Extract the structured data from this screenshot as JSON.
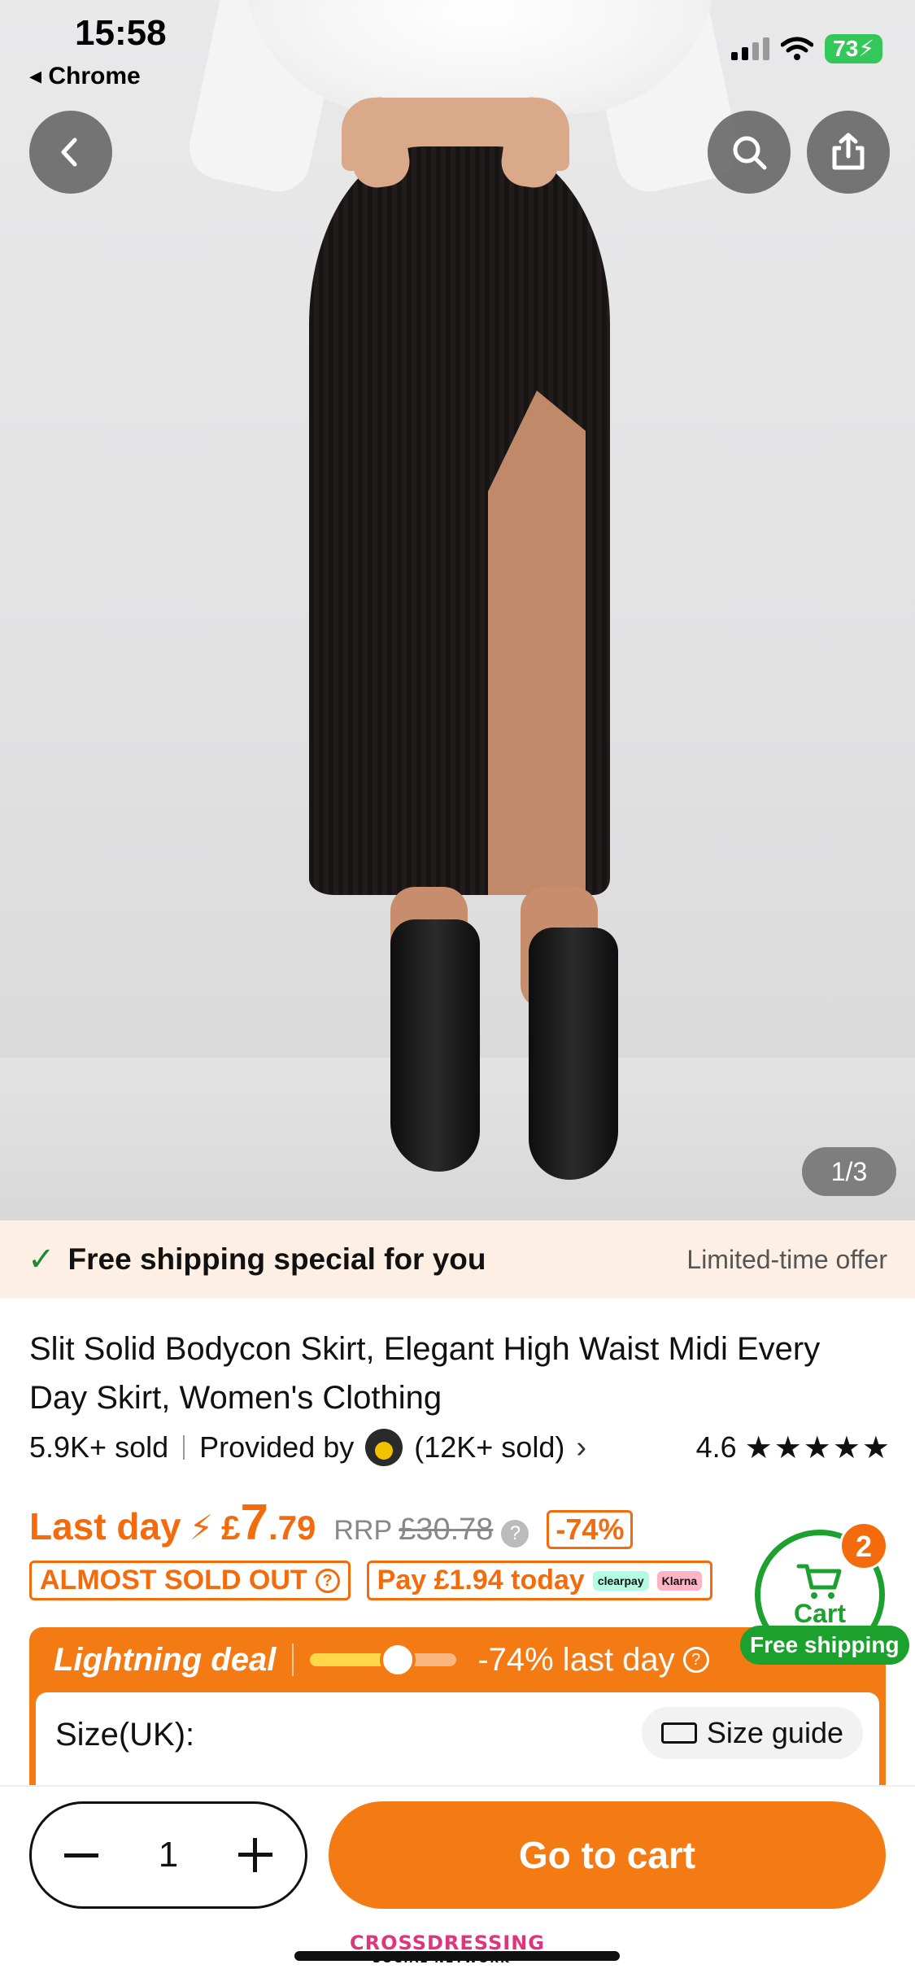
{
  "status": {
    "time": "15:58",
    "back_app": "◂ Chrome",
    "battery": "73"
  },
  "gallery": {
    "counter": "1/3"
  },
  "shipping": {
    "check": "✓",
    "text": "Free shipping special for you",
    "offer": "Limited-time offer"
  },
  "product": {
    "title": "Slit Solid Bodycon Skirt, Elegant High Waist Midi Every Day Skirt, Women's Clothing",
    "sold": "5.9K+ sold",
    "provided_by": "Provided by",
    "seller_sold": "(12K+ sold)",
    "rating": "4.6",
    "stars": "★★★★★"
  },
  "price": {
    "last_day": "Last day",
    "bolt": "⚡",
    "currency": "£",
    "integer": "7",
    "decimal": ".79",
    "rrp_label": "RRP",
    "rrp_value": "£30.78",
    "discount": "-74%"
  },
  "badges": {
    "almost_sold_out": "ALMOST SOLD OUT",
    "pay_today": "Pay £1.94 today",
    "clearpay": "clearpay",
    "klarna": "Klarna"
  },
  "deal": {
    "label": "Lightning deal",
    "progress": 0.6,
    "text": "-74% last day",
    "size_label": "Size(UK):",
    "size_guide": "Size guide"
  },
  "cart": {
    "count": "2",
    "label": "Cart",
    "free_shipping": "Free shipping"
  },
  "bottom": {
    "quantity": "1",
    "go_to_cart": "Go to cart"
  },
  "watermark": {
    "line1": "CROSSDRESSING",
    "line2": "SOCIAL NETWORK"
  },
  "colors": {
    "accent": "#f47a14",
    "green": "#1ca02e"
  }
}
